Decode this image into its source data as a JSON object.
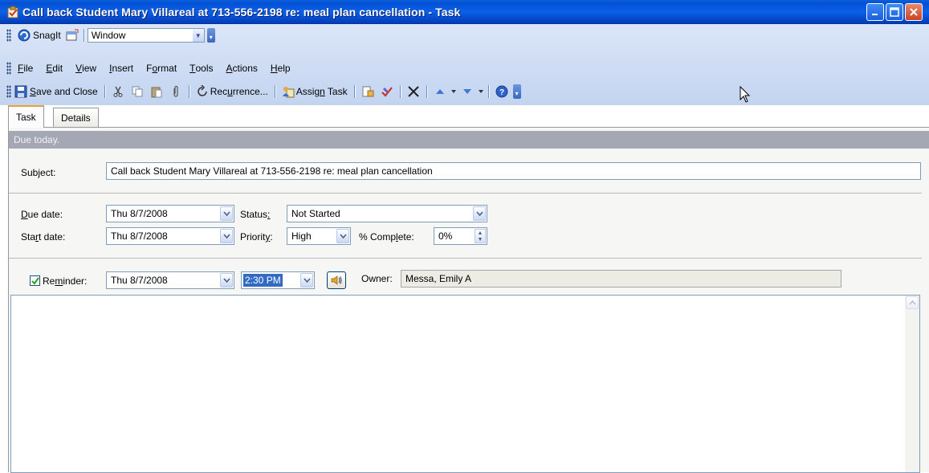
{
  "window": {
    "title": "Call back Student Mary Villareal at 713-556-2198 re: meal plan cancellation - Task"
  },
  "snagit_bar": {
    "snagit_label": "SnagIt",
    "capture_mode": "Window"
  },
  "menu": {
    "items": [
      {
        "label": "File",
        "accel": "F",
        "rest": "ile"
      },
      {
        "label": "Edit",
        "accel": "E",
        "rest": "dit"
      },
      {
        "label": "View",
        "accel": "V",
        "rest": "iew"
      },
      {
        "label": "Insert",
        "accel": "I",
        "rest": "nsert"
      },
      {
        "label": "Format",
        "pre": "F",
        "accel": "o",
        "rest": "rmat"
      },
      {
        "label": "Tools",
        "accel": "T",
        "rest": "ools"
      },
      {
        "label": "Actions",
        "accel": "A",
        "rest": "ctions"
      },
      {
        "label": "Help",
        "accel": "H",
        "rest": "elp"
      }
    ]
  },
  "toolbar": {
    "save_close": {
      "accel": "S",
      "rest": "ave and Close"
    },
    "recurrence": {
      "pre": "Rec",
      "accel": "u",
      "rest": "rrence..."
    },
    "assign_task": {
      "pre": "Assig",
      "accel": "n",
      "rest": " Task"
    }
  },
  "tabs": [
    {
      "label": "Task",
      "active": true
    },
    {
      "label": "Details",
      "active": false
    }
  ],
  "form": {
    "due_banner": "Due today.",
    "subject_label": "Subject:",
    "subject_value": "Call back Student Mary Villareal at 713-556-2198 re: meal plan cancellation",
    "due_date_label": {
      "accel": "D",
      "rest": "ue date:"
    },
    "due_date_value": "Thu 8/7/2008",
    "start_date_label": {
      "pre": "Sta",
      "accel": "r",
      "rest": "t date:"
    },
    "start_date_value": "Thu 8/7/2008",
    "status_label": {
      "pre": "Status",
      "accel": ":",
      "rest": ""
    },
    "status_value": "Not Started",
    "priority_label": {
      "pre": "Priorit",
      "accel": "y",
      "rest": ":"
    },
    "priority_value": "High",
    "complete_label": {
      "pre": "% Comp",
      "accel": "l",
      "rest": "ete:"
    },
    "complete_value": "0%",
    "reminder_checked": true,
    "reminder_label": {
      "pre": "Re",
      "accel": "m",
      "rest": "inder:"
    },
    "reminder_date_value": "Thu 8/7/2008",
    "reminder_time_value": "2:30 PM",
    "owner_label": "Owner:",
    "owner_value": "Messa, Emily A",
    "notes_value": ""
  },
  "colors": {
    "titlebar": "#0b61e6",
    "toolbar_band": "#c3d4f0",
    "due_banner": "#a4a8b4",
    "tab_accent": "#e6a236",
    "selection": "#316ac5"
  }
}
